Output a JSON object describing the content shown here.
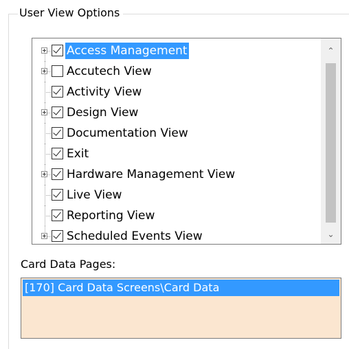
{
  "group": {
    "title": "User View Options"
  },
  "tree": {
    "items": [
      {
        "label": "Access Management",
        "checked": true,
        "expandable": true,
        "selected": true
      },
      {
        "label": "Accutech View",
        "checked": false,
        "expandable": true,
        "selected": false
      },
      {
        "label": "Activity View",
        "checked": true,
        "expandable": false,
        "selected": false
      },
      {
        "label": "Design View",
        "checked": true,
        "expandable": true,
        "selected": false
      },
      {
        "label": "Documentation View",
        "checked": true,
        "expandable": false,
        "selected": false
      },
      {
        "label": "Exit",
        "checked": true,
        "expandable": false,
        "selected": false
      },
      {
        "label": "Hardware Management View",
        "checked": true,
        "expandable": true,
        "selected": false
      },
      {
        "label": "Live View",
        "checked": true,
        "expandable": false,
        "selected": false
      },
      {
        "label": "Reporting View",
        "checked": true,
        "expandable": false,
        "selected": false
      },
      {
        "label": "Scheduled Events View",
        "checked": true,
        "expandable": true,
        "selected": false
      }
    ],
    "scroll_up_glyph": "⌃",
    "scroll_down_glyph": "⌄"
  },
  "card_data": {
    "label": "Card Data Pages:",
    "items": [
      {
        "text": "[170] Card Data Screens\\Card Data",
        "selected": true
      }
    ]
  },
  "colors": {
    "selection": "#3399ff",
    "card_list_background": "#fbe6d0"
  },
  "icons": {
    "expander": "plus-box-icon",
    "checkbox": "checkbox-icon",
    "scroll_up": "chevron-up-icon",
    "scroll_down": "chevron-down-icon"
  }
}
